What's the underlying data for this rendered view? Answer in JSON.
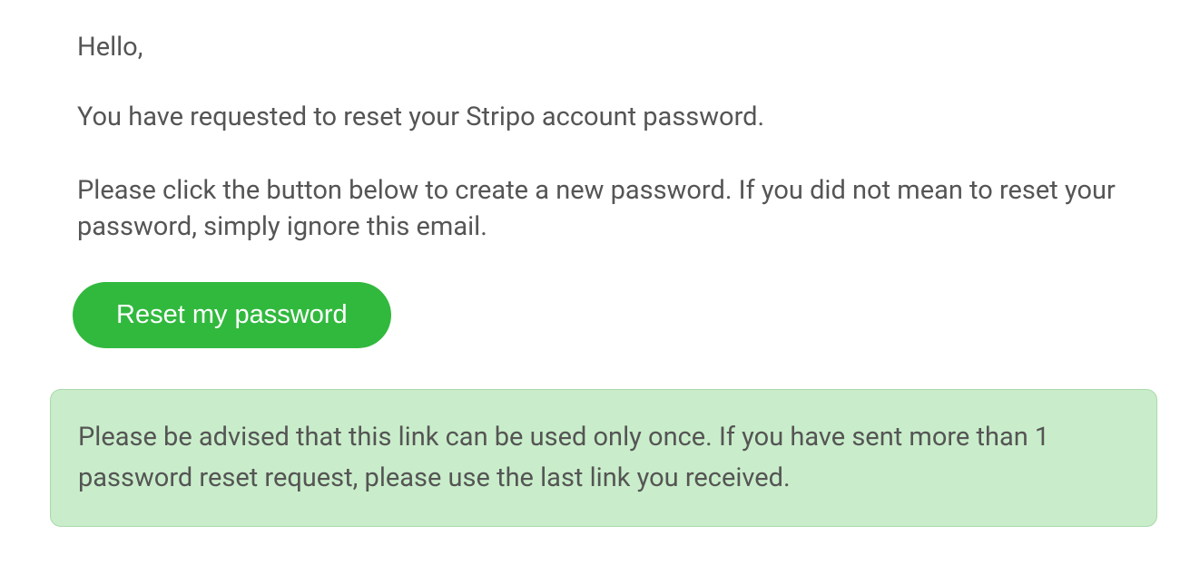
{
  "email": {
    "greeting": "Hello,",
    "paragraph1": "You have requested to reset your Stripo account password.",
    "paragraph2": "Please click the button below to create a new password. If you did not mean to reset your password, simply ignore this email.",
    "reset_button_label": "Reset my password",
    "advisory": "Please be advised that this link can be used only once. If you have sent more than 1 password reset request, please use the last link you received."
  },
  "colors": {
    "button_bg": "#31b93e",
    "advisory_bg": "#c9edca",
    "advisory_border": "#aad9ab",
    "text": "#555555"
  }
}
